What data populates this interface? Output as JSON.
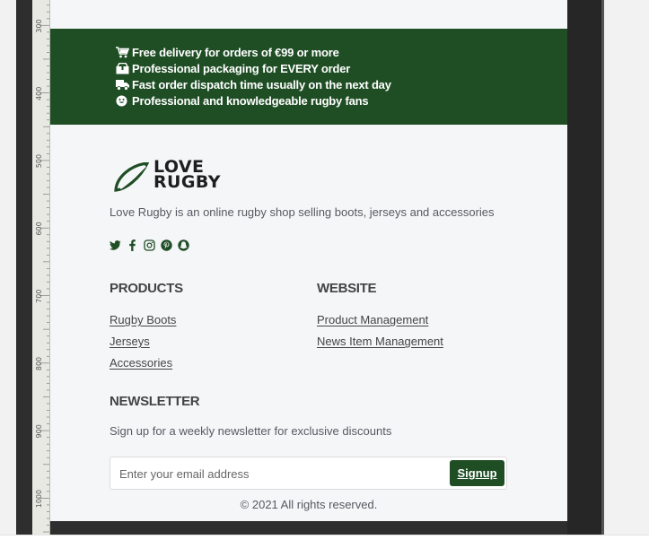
{
  "benefits": [
    {
      "icon": "cart-icon",
      "text": "Free delivery for orders of €99 or more"
    },
    {
      "icon": "package-icon",
      "text": "Professional packaging for EVERY order"
    },
    {
      "icon": "truck-icon",
      "text": "Fast order dispatch time usually on the next day"
    },
    {
      "icon": "smile-icon",
      "text": "Professional and knowledgeable rugby fans"
    }
  ],
  "brand": {
    "logo_line1": "LOVE",
    "logo_line2": "RUGBY",
    "tagline": "Love Rugby is an online rugby shop selling boots, jerseys and accessories"
  },
  "social_icons": [
    "twitter-icon",
    "facebook-icon",
    "instagram-icon",
    "pinterest-icon",
    "snapchat-icon"
  ],
  "products": {
    "title": "PRODUCTS",
    "links": [
      "Rugby Boots",
      "Jerseys",
      "Accessories"
    ]
  },
  "website": {
    "title": "WEBSITE",
    "links": [
      "Product Management",
      "News Item Management"
    ]
  },
  "newsletter": {
    "title": "NEWSLETTER",
    "description": "Sign up for a weekly newsletter for exclusive discounts",
    "email_placeholder": "Enter your email address",
    "signup_label": "Signup"
  },
  "footer": {
    "copyright": "© 2021 All rights reserved."
  },
  "ruler_labels": [
    "300",
    "400",
    "500",
    "600",
    "700",
    "800",
    "900",
    "1000"
  ],
  "colors": {
    "brand_green": "#1f4e25",
    "background": "#f5f6f8",
    "text": "#555a60"
  }
}
